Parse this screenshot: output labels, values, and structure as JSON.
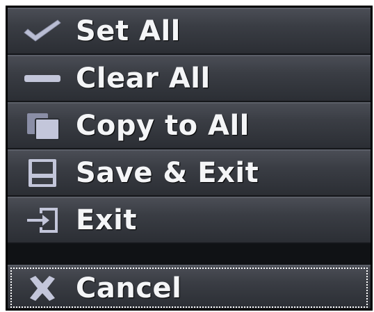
{
  "menu": {
    "items": [
      {
        "label": "Set All",
        "icon": "checkmark-icon"
      },
      {
        "label": "Clear All",
        "icon": "minus-icon"
      },
      {
        "label": "Copy to All",
        "icon": "copy-icon"
      },
      {
        "label": "Save & Exit",
        "icon": "save-icon"
      },
      {
        "label": "Exit",
        "icon": "exit-icon"
      },
      {
        "label": "Cancel",
        "icon": "x-icon",
        "focused": true
      }
    ]
  },
  "colors": {
    "item_bg_top": "#4a4d55",
    "item_bg_bottom": "#2b2e34",
    "text": "#f4f5f7",
    "icon": "#b9bdd3",
    "border": "#000000",
    "focus_outline": "#ffffff"
  }
}
